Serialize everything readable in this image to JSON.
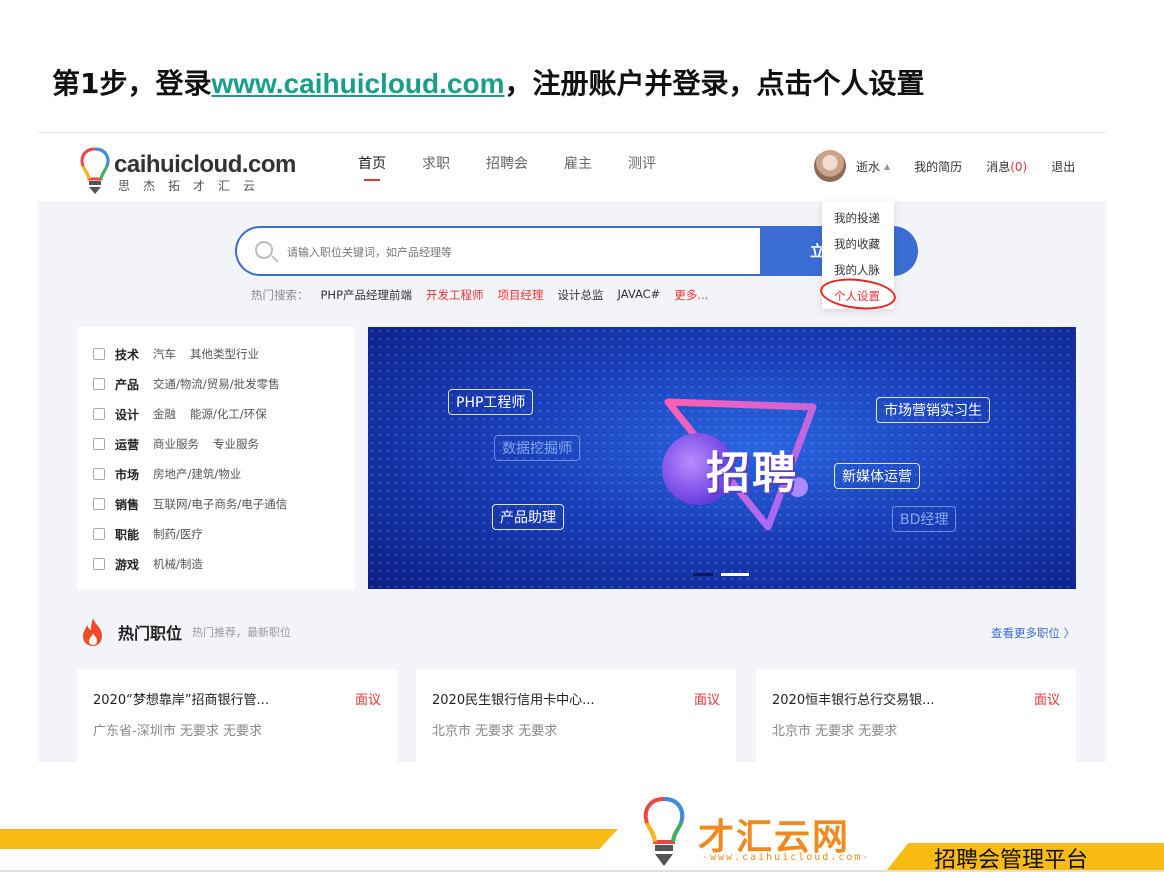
{
  "slide": {
    "title_prefix": "第1步，登录",
    "title_url": "www.caihuicloud.com",
    "title_suffix": "，注册账户并登录，点击个人设置"
  },
  "site": {
    "brand": "caihuicloud.com",
    "brand_sub": "思杰拓才汇云",
    "nav": [
      "首页",
      "求职",
      "招聘会",
      "雇主",
      "测评"
    ],
    "user": {
      "name": "逝水",
      "my_resume": "我的简历",
      "messages_label": "消息",
      "messages_count": "(0)",
      "logout": "退出"
    },
    "dropdown": [
      "我的投递",
      "我的收藏",
      "我的人脉",
      "个人设置"
    ],
    "search": {
      "placeholder": "请输入职位关键词，如产品经理等",
      "button": "立"
    },
    "hot_search": {
      "label": "热门搜索：",
      "keywords": [
        "PHP产品经理前端",
        "开发工程师",
        "项目经理",
        "设计总监",
        "JAVAC#",
        "更多..."
      ]
    },
    "categories": [
      {
        "name": "技术",
        "subs": [
          "汽车",
          "其他类型行业"
        ]
      },
      {
        "name": "产品",
        "subs": [
          "交通/物流/贸易/批发零售"
        ]
      },
      {
        "name": "设计",
        "subs": [
          "金融",
          "能源/化工/环保"
        ]
      },
      {
        "name": "运营",
        "subs": [
          "商业服务",
          "专业服务"
        ]
      },
      {
        "name": "市场",
        "subs": [
          "房地产/建筑/物业"
        ]
      },
      {
        "name": "销售",
        "subs": [
          "互联网/电子商务/电子通信"
        ]
      },
      {
        "name": "职能",
        "subs": [
          "制药/医疗"
        ]
      },
      {
        "name": "游戏",
        "subs": [
          "机械/制造"
        ]
      }
    ],
    "banner": {
      "main": "招聘",
      "tags": [
        "PHP工程师",
        "数据挖掘师",
        "产品助理",
        "市场营销实习生",
        "新媒体运营",
        "BD经理"
      ]
    },
    "hot_jobs": {
      "title": "热门职位",
      "subtitle": "热门推荐，最新职位",
      "more": "查看更多职位 〉",
      "jobs": [
        {
          "title": "2020“梦想靠岸”招商银行管...",
          "salary": "面议",
          "meta": "广东省-深圳市  无要求  无要求"
        },
        {
          "title": "2020民生银行信用卡中心...",
          "salary": "面议",
          "meta": "北京市  无要求  无要求"
        },
        {
          "title": "2020恒丰银行总行交易银...",
          "salary": "面议",
          "meta": "北京市  无要求  无要求"
        }
      ]
    }
  },
  "footer": {
    "brand": "才汇云网",
    "url": "-www.caihuicloud.com-",
    "platform": "招聘会管理平台"
  },
  "colors": {
    "accent_blue": "#3b6dd4",
    "accent_red": "#e33333",
    "footer_yellow": "#f7bb14",
    "footer_orange": "#f08a1e"
  }
}
